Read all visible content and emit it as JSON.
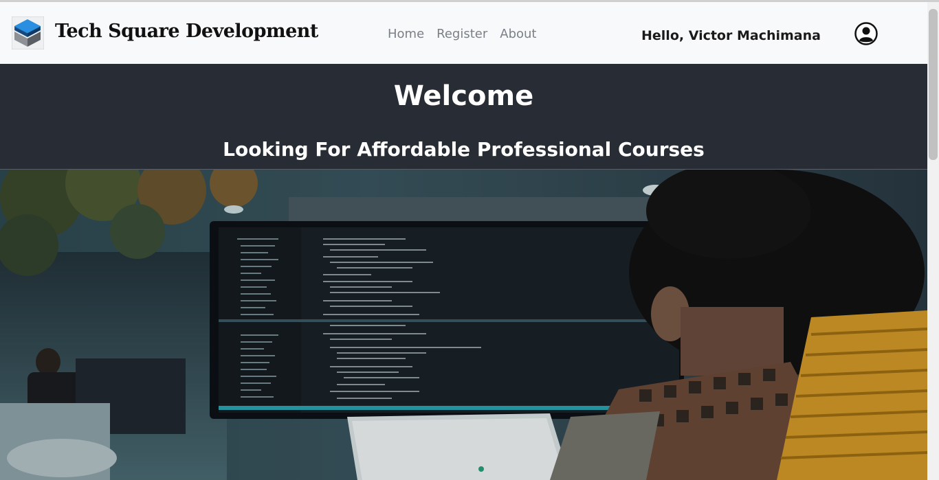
{
  "navbar": {
    "brand": "Tech Square Development",
    "links": [
      "Home",
      "Register",
      "About"
    ],
    "greeting": "Hello, Victor Machimana"
  },
  "hero": {
    "title": "Welcome",
    "subtitle": "Looking For Affordable Professional Courses"
  },
  "icons": {
    "logo": "cube-logo-icon",
    "account": "user-account-icon"
  },
  "colors": {
    "navbar_bg": "#f8f9fa",
    "hero_bg": "#282c35",
    "nav_link": "#7a7f85"
  }
}
